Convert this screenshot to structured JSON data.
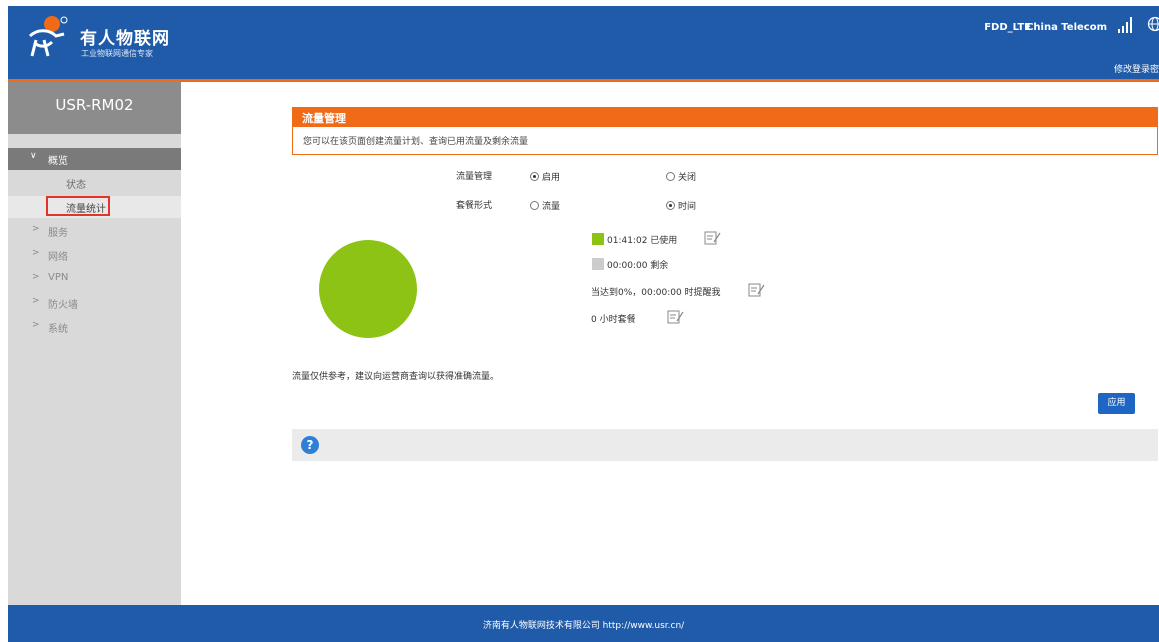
{
  "header": {
    "brand": "有人物联网",
    "brand_sub": "工业物联网通信专家",
    "network_type": "FDD_LTE",
    "carrier": "China Telecom",
    "change_password": "修改登录密"
  },
  "sidebar": {
    "device_name": "USR-RM02",
    "group_overview": "概览",
    "sub_status": "状态",
    "sub_traffic_stats": "流量统计",
    "items": [
      "服务",
      "网络",
      "VPN",
      "防火墙",
      "系统"
    ]
  },
  "panel": {
    "title": "流量管理",
    "description": "您可以在该页面创建流量计划、查询已用流量及剩余流量"
  },
  "form": {
    "traffic_mgmt_label": "流量管理",
    "enable_label": "启用",
    "disable_label": "关闭",
    "traffic_mgmt_enabled": true,
    "plan_type_label": "套餐形式",
    "plan_traffic_label": "流量",
    "plan_time_label": "时间",
    "plan_type_selected": "时间"
  },
  "usage": {
    "used_text": "01:41:02 已使用",
    "remaining_text": "00:00:00 剩余",
    "alert_text": "当达到0%，00:00:00 时提醒我",
    "plan_text": "0 小时套餐",
    "used_color": "#8cc314",
    "remaining_color": "#cccccc"
  },
  "chart_data": {
    "type": "pie",
    "categories": [
      "已使用",
      "剩余"
    ],
    "values": [
      1,
      0
    ]
  },
  "note": "流量仅供参考，建议向运营商查询以获得准确流量。",
  "apply_label": "应用",
  "footer": "济南有人物联网技术有限公司 http://www.usr.cn/",
  "colors": {
    "header_blue": "#1f5ba8",
    "accent_orange": "#f06a18"
  }
}
